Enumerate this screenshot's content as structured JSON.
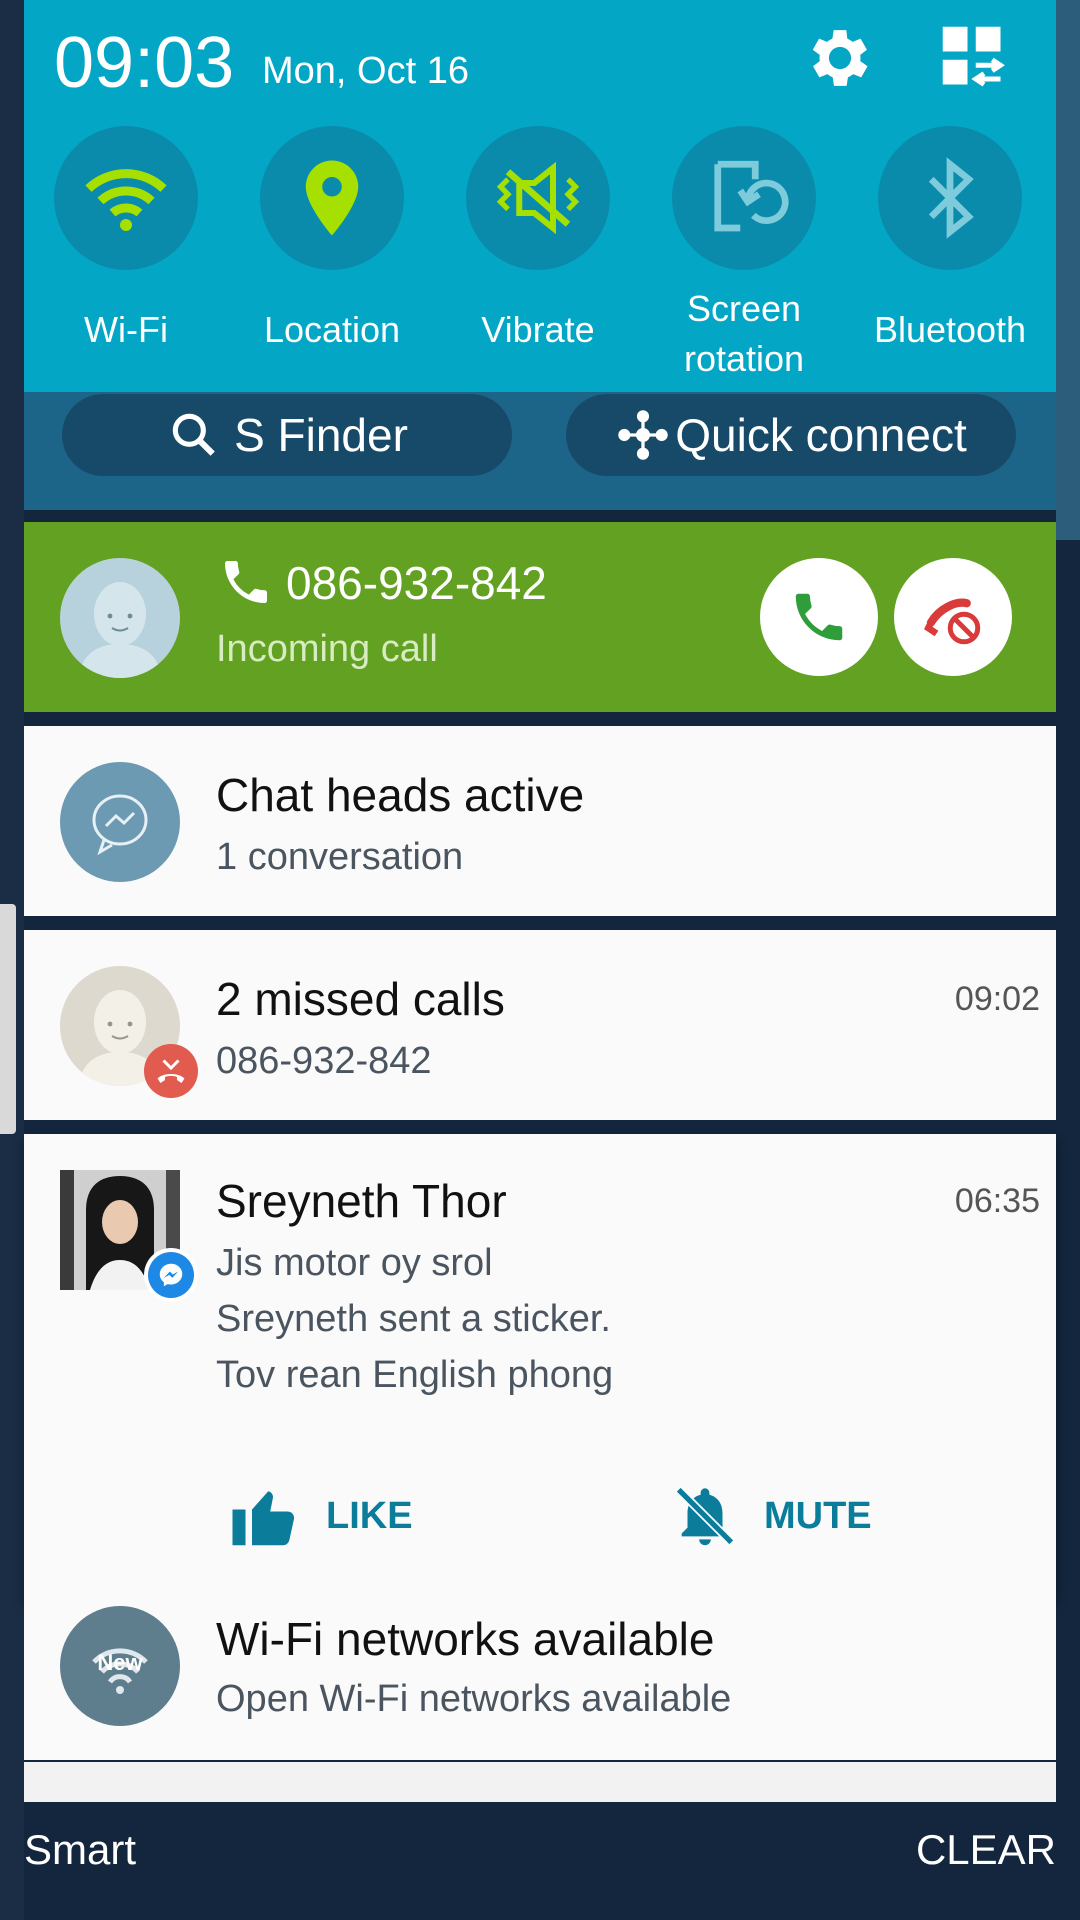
{
  "status": {
    "time": "09:03",
    "date": "Mon, Oct 16"
  },
  "quick_settings": [
    {
      "label": "Wi-Fi",
      "icon": "wifi-icon",
      "active": true
    },
    {
      "label": "Location",
      "icon": "location-icon",
      "active": true
    },
    {
      "label": "Vibrate",
      "icon": "vibrate-icon",
      "active": true
    },
    {
      "label_line1": "Screen",
      "label_line2": "rotation",
      "icon": "screen-rotation-icon",
      "active": false
    },
    {
      "label": "Bluetooth",
      "icon": "bluetooth-icon",
      "active": false
    }
  ],
  "shortcuts": {
    "s_finder": "S Finder",
    "quick_connect": "Quick connect"
  },
  "incoming_call": {
    "number": "086-932-842",
    "status": "Incoming call"
  },
  "notifications": {
    "chat_heads": {
      "title": "Chat heads active",
      "subtitle": "1 conversation"
    },
    "missed_calls": {
      "title": "2 missed calls",
      "subtitle": "086-932-842",
      "time": "09:02"
    },
    "messenger": {
      "title": "Sreyneth Thor",
      "time": "06:35",
      "lines": [
        "Jis motor oy srol",
        "Sreyneth sent a sticker.",
        "Tov rean English phong"
      ],
      "like_label": "LIKE",
      "mute_label": "MUTE"
    },
    "wifi": {
      "title": "Wi-Fi networks available",
      "subtitle": "Open Wi-Fi networks available",
      "badge": "New"
    }
  },
  "bottom": {
    "smart": "Smart",
    "clear": "CLEAR"
  },
  "colors": {
    "panel": "#04a6c6",
    "accent_green": "#a5e000",
    "call_card": "#62a121",
    "action": "#0b7d9a",
    "background": "#13263d"
  }
}
